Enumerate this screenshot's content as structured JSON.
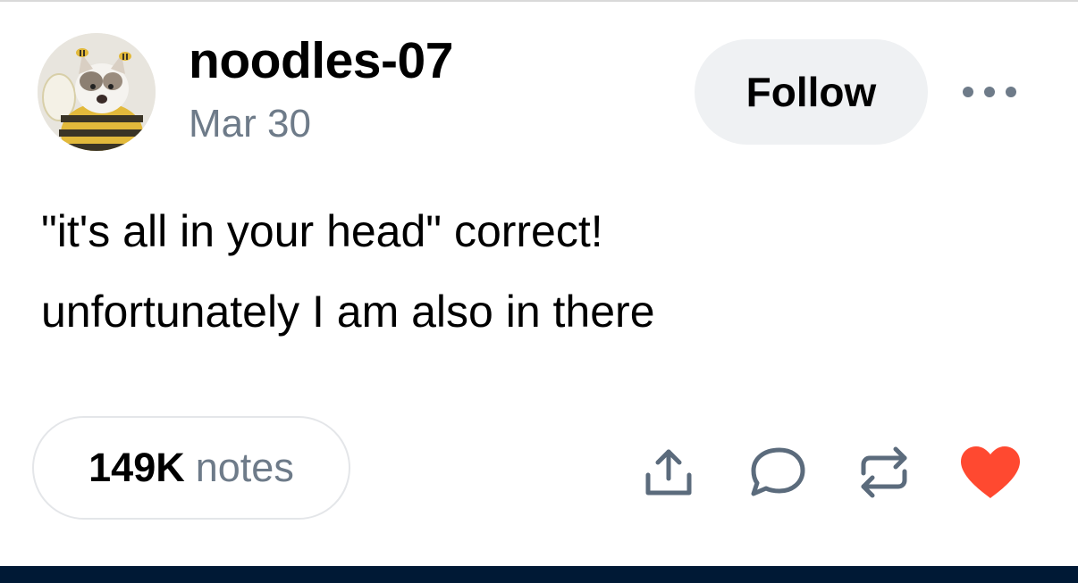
{
  "post": {
    "author": {
      "username": "noodles-07",
      "avatar_icon": "cat-in-bee-costume-avatar"
    },
    "date": "Mar 30",
    "follow_label": "Follow",
    "more_icon": "ellipsis-icon",
    "body": [
      "\"it's all in your head\" correct!",
      "unfortunately I am also in there"
    ],
    "notes": {
      "count": "149K",
      "label": "notes"
    },
    "actions": [
      {
        "name": "share",
        "icon": "share-icon"
      },
      {
        "name": "reply",
        "icon": "reply-icon"
      },
      {
        "name": "reblog",
        "icon": "reblog-icon"
      },
      {
        "name": "like",
        "icon": "heart-icon"
      }
    ]
  },
  "colors": {
    "text": "#000000",
    "muted": "#6e7b89",
    "follow_bg": "#eff1f3",
    "icon": "#5b6b7c",
    "like": "#ff4930",
    "bottom_bar": "#001935"
  }
}
